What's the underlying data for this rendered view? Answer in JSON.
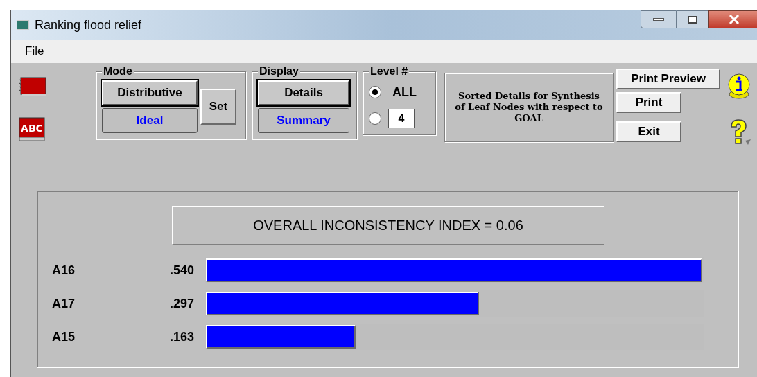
{
  "window": {
    "title": "Ranking flood relief"
  },
  "menu": [
    "File"
  ],
  "toolbar_icon_text": "ABC",
  "mode": {
    "label": "Mode",
    "options": [
      {
        "label": "Distributive",
        "selected": true
      },
      {
        "label": "Ideal",
        "selected": false
      }
    ],
    "set_button": "Set"
  },
  "display": {
    "label": "Display",
    "options": [
      {
        "label": "Details",
        "selected": true
      },
      {
        "label": "Summary",
        "selected": false
      }
    ]
  },
  "level": {
    "label": "Level #",
    "options": [
      {
        "label": "ALL",
        "selected": true
      },
      {
        "value": "4",
        "selected": false
      }
    ]
  },
  "description": "Sorted Details for Synthesis of Leaf Nodes with respect to GOAL",
  "buttons": [
    "Print Preview",
    "Print",
    "Exit"
  ],
  "chart": {
    "title": "OVERALL INCONSISTENCY INDEX =  0.06",
    "rows": [
      {
        "name": "A16",
        "value": ".540",
        "level": 1
      },
      {
        "name": "A17",
        "value": ".297",
        "level": 0.55
      },
      {
        "name": "A15",
        "value": ".163",
        "level": 0.302
      }
    ]
  }
}
